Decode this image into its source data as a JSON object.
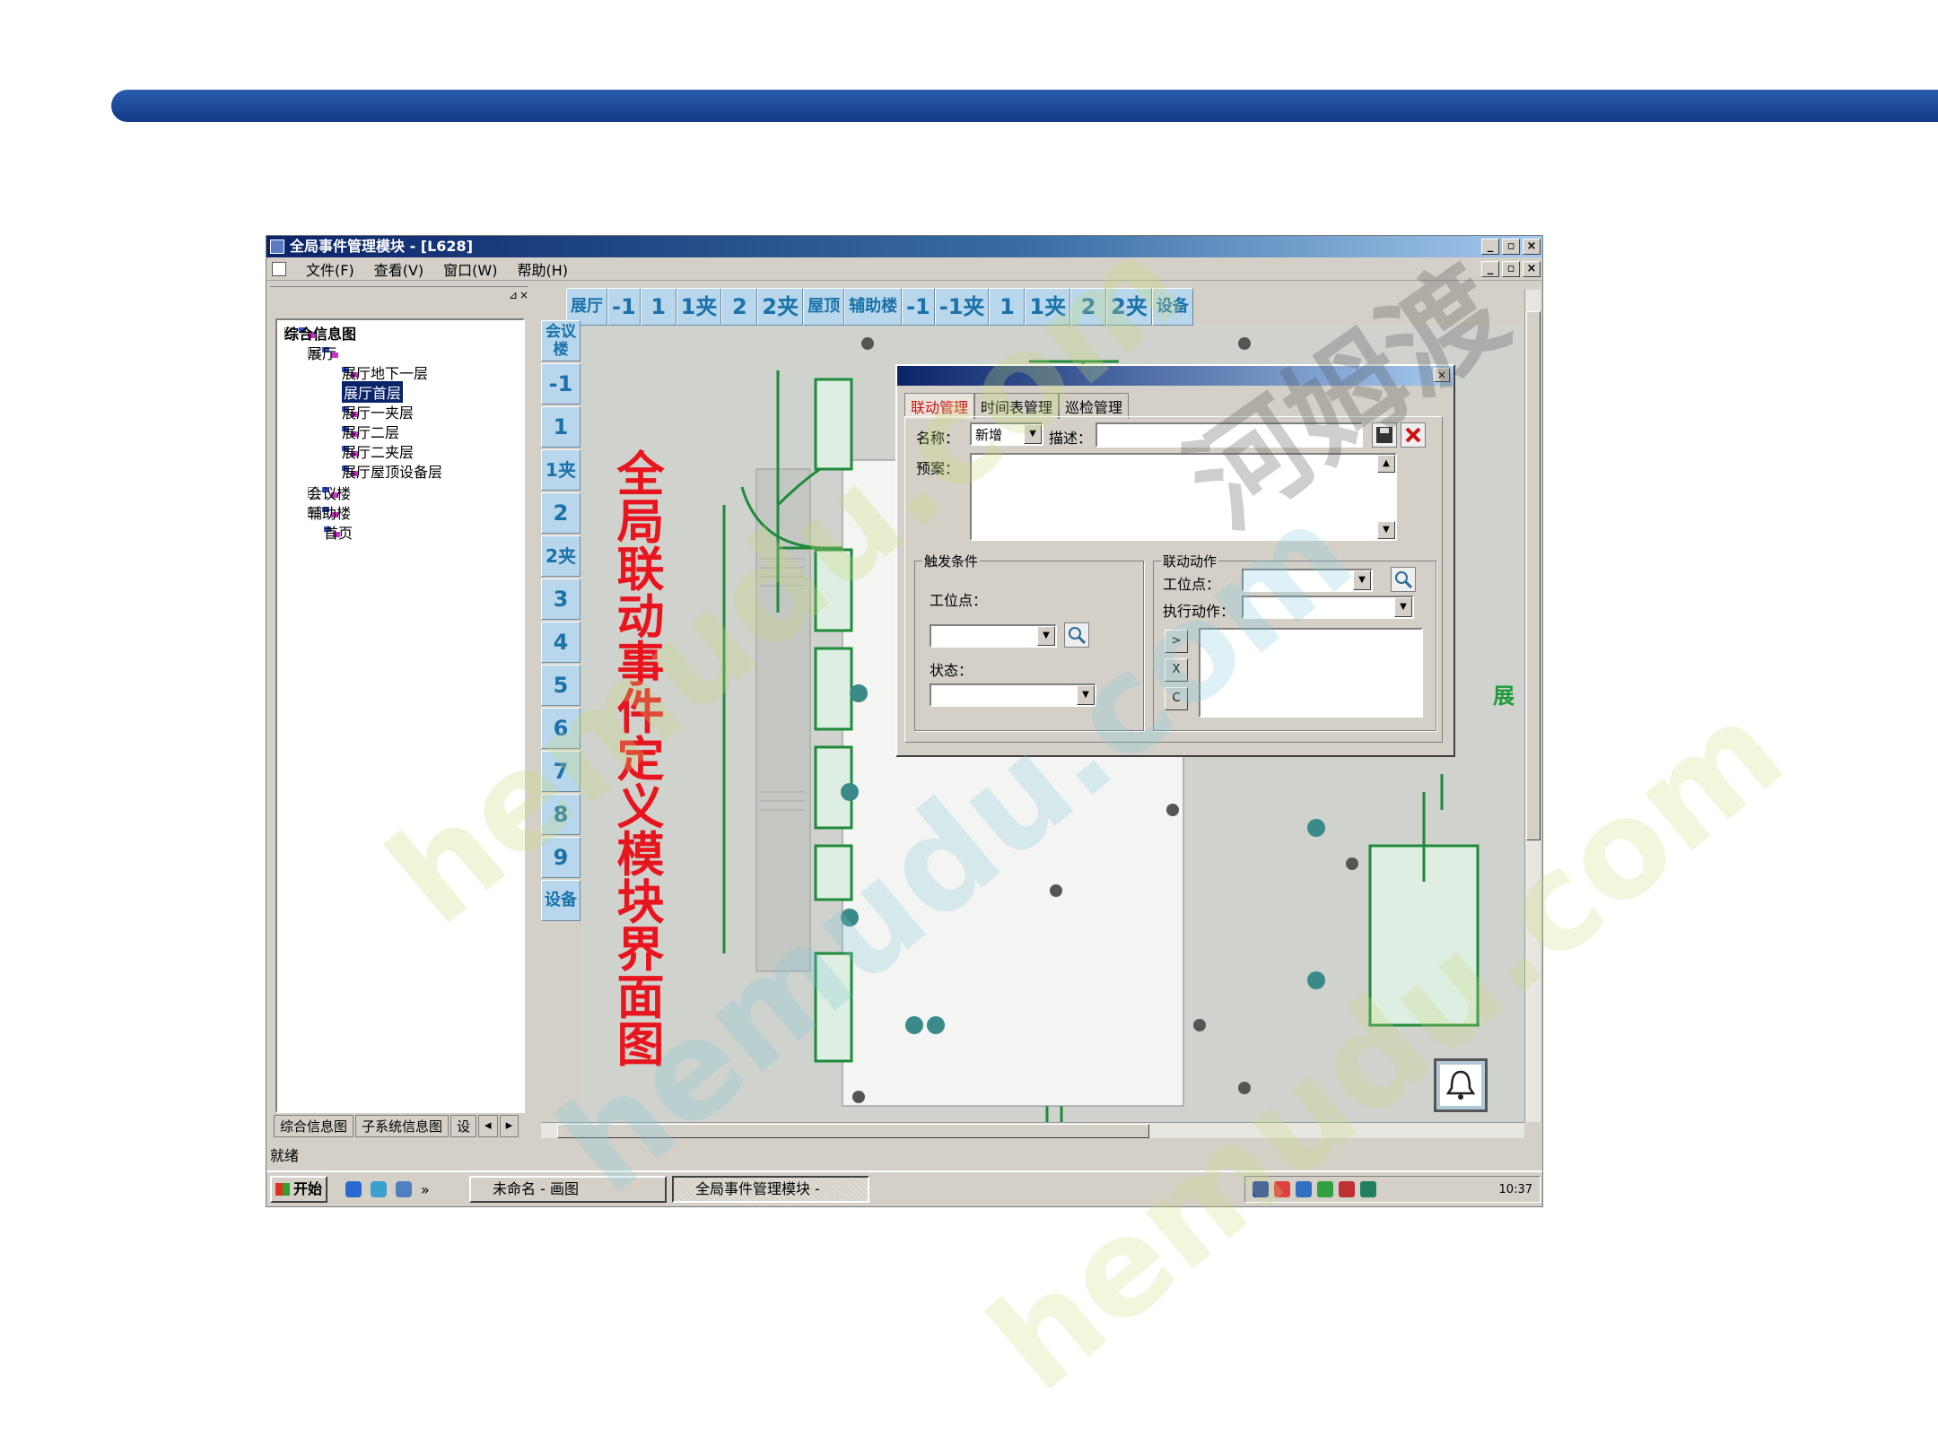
{
  "app": {
    "title": "全局事件管理模块 - [L628]",
    "menu": [
      "文件(F)",
      "查看(V)",
      "窗口(W)",
      "帮助(H)"
    ]
  },
  "tree": {
    "root": "综合信息图",
    "hall": "展厅",
    "hall_items": [
      "展厅地下一层",
      "展厅首层",
      "展厅一夹层",
      "展厅二层",
      "展厅二夹层",
      "展厅屋顶设备层"
    ],
    "selected": "展厅首层",
    "others": [
      "会议楼",
      "辅助楼",
      "首页"
    ],
    "bottom_tabs": [
      "综合信息图",
      "子系统信息图",
      "设"
    ]
  },
  "floor_bar": [
    "展厅",
    "-1",
    "1",
    "1夹",
    "2",
    "2夹",
    "屋顶",
    "辅助楼",
    "-1",
    "-1夹",
    "1",
    "1夹",
    "2",
    "2夹",
    "设备"
  ],
  "floor_col": [
    "会议楼",
    "-1",
    "1",
    "1夹",
    "2",
    "2夹",
    "3",
    "4",
    "5",
    "6",
    "7",
    "8",
    "9",
    "设备"
  ],
  "dialog": {
    "tabs": [
      "联动管理",
      "时间表管理",
      "巡检管理"
    ],
    "name_label": "名称：",
    "name_value": "新增",
    "desc_label": "描述：",
    "plan_label": "预案：",
    "trigger_legend": "触发条件",
    "point_label": "工位点：",
    "state_label": "状态：",
    "action_legend": "联动动作",
    "action_point_label": "工位点：",
    "exec_label": "执行动作：",
    "btn_add": ">",
    "btn_del": "X",
    "btn_clear": "C"
  },
  "overlay_title": "全局联动事件定义模块界面图",
  "side_label": "展",
  "status": "就绪",
  "taskbar": {
    "start": "开始",
    "quick_more": "»",
    "task1": "未命名 - 画图",
    "task2": "全局事件管理模块 -",
    "clock": "10:37"
  },
  "watermarks": [
    "河姆渡",
    "hemudu.com",
    "hemudu.com",
    "hemudu.com"
  ],
  "colors": {
    "accent_blue": "#1a3f8a",
    "floor_btn": "#b8d6ec",
    "red_title": "#e8141e",
    "map_green": "#1e8a3a"
  }
}
